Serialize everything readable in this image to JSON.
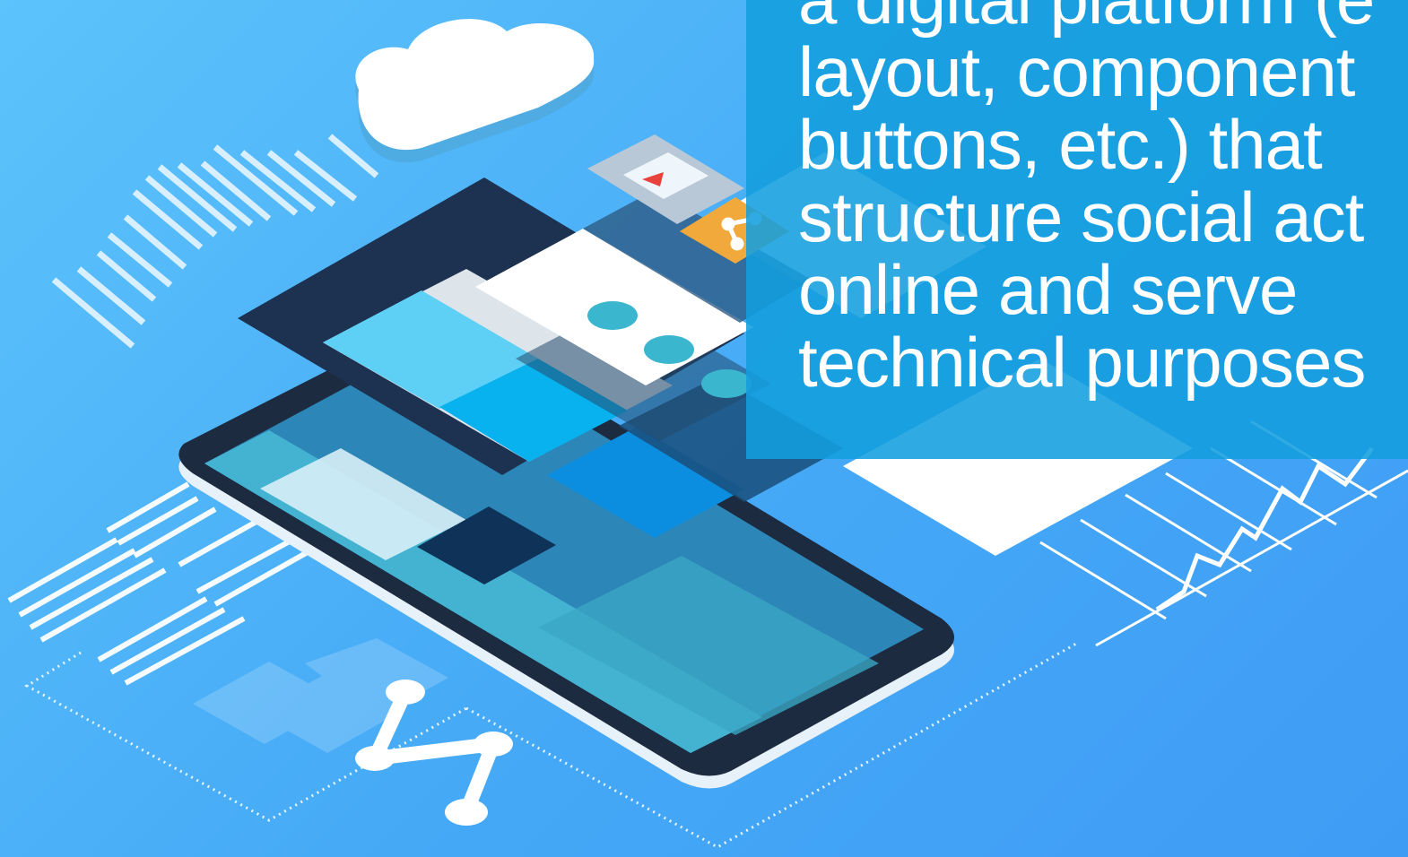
{
  "caption": {
    "lines": [
      "a digital platform (e",
      "layout, component",
      "buttons, etc.) that",
      "structure social act",
      "online and serve",
      "technical purposes"
    ]
  },
  "colors": {
    "background": "#4aaaf6",
    "panel": "#139ede",
    "phone_frame": "#1c2b3f",
    "accent_orange": "#f2a93b",
    "accent_teal": "#3bb6cf"
  },
  "icons": [
    "cloud-icon",
    "play-icon",
    "share-node-icon",
    "large-share-node-icon"
  ]
}
